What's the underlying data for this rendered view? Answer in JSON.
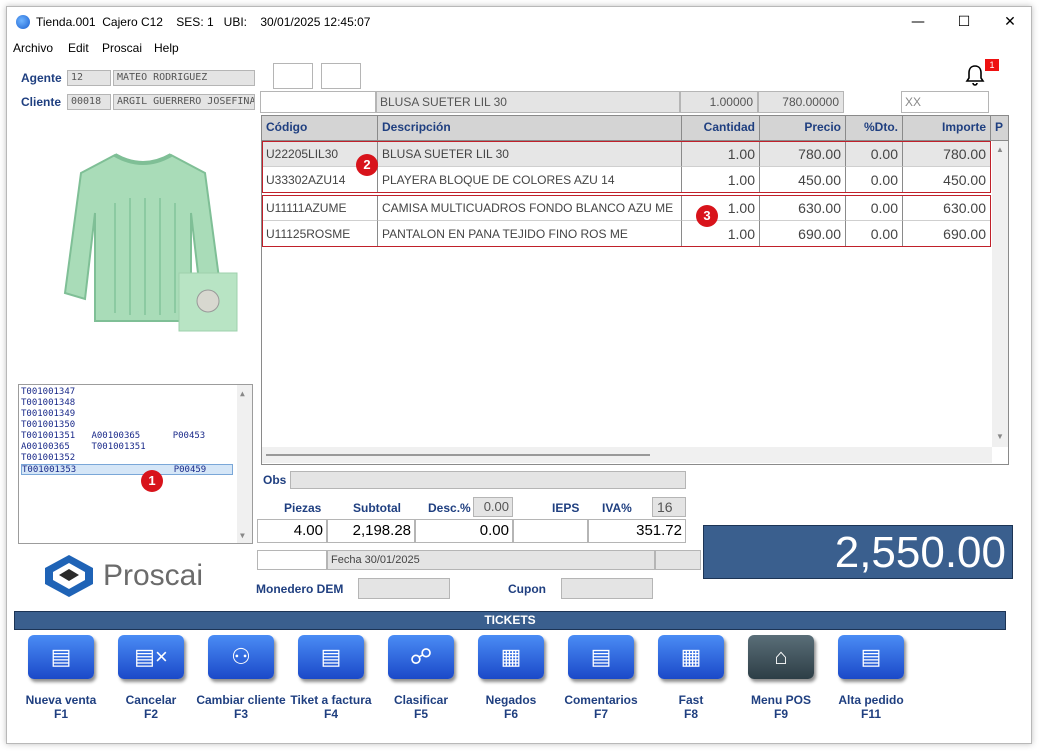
{
  "window": {
    "title": "Tienda.001  Cajero C12    SES: 1   UBI:    30/01/2025 12:45:07",
    "minimize": "—",
    "maximize": "☐",
    "close": "✕"
  },
  "menu": [
    "Archivo",
    "Edit",
    "Proscai",
    "Help"
  ],
  "notification": {
    "count": "1",
    "icon": "bell-icon"
  },
  "agente": {
    "label": "Agente",
    "code": "12",
    "name": "MATEO RODRIGUEZ"
  },
  "cliente": {
    "label": "Cliente",
    "code": "00018",
    "name": "ARGIL GUERRERO JOSEFINA"
  },
  "entry": {
    "desc": "BLUSA SUETER LIL 30",
    "qty": "1.00000",
    "price": "780.00000",
    "code": "XX"
  },
  "grid": {
    "headers": [
      "Código",
      "Descripción",
      "Cantidad",
      "Precio",
      "%Dto.",
      "Importe",
      "P"
    ],
    "rows": [
      {
        "codigo": "U22205LIL30",
        "descripcion": "BLUSA SUETER LIL 30",
        "cantidad": "1.00",
        "precio": "780.00",
        "dto": "0.00",
        "importe": "780.00"
      },
      {
        "codigo": "U33302AZU14",
        "descripcion": "PLAYERA BLOQUE DE COLORES AZU 14",
        "cantidad": "1.00",
        "precio": "450.00",
        "dto": "0.00",
        "importe": "450.00"
      },
      {
        "codigo": "U11111AZUME",
        "descripcion": "CAMISA MULTICUADROS FONDO BLANCO AZU ME",
        "cantidad": "1.00",
        "precio": "630.00",
        "dto": "0.00",
        "importe": "630.00"
      },
      {
        "codigo": "U11125ROSME",
        "descripcion": "PANTALON EN PANA  TEJIDO FINO ROS ME",
        "cantidad": "1.00",
        "precio": "690.00",
        "dto": "0.00",
        "importe": "690.00"
      }
    ]
  },
  "tickets_list": [
    "T001001347",
    "T001001348",
    "T001001349",
    "T001001350",
    "T001001351   A00100365      P00453",
    "A00100365    T001001351",
    "T001001352",
    "T001001353                  P00459"
  ],
  "annotations": [
    "1",
    "2",
    "3"
  ],
  "obs": {
    "label": "Obs",
    "value": ""
  },
  "totals": {
    "piezas_label": "Piezas",
    "piezas": "4.00",
    "subtotal_label": "Subtotal",
    "subtotal": "2,198.28",
    "desc_label": "Desc.%",
    "desc_pct": "0.00",
    "desc": "0.00",
    "ieps_label": "IEPS",
    "ieps": "",
    "iva_label": "IVA%",
    "iva_pct": "16",
    "iva": "351.72",
    "total": "2,550.00"
  },
  "fecha": "Fecha 30/01/2025",
  "monedero": {
    "label": "Monedero DEM",
    "value": ""
  },
  "cupon": {
    "label": "Cupon",
    "value": ""
  },
  "logo": "Proscai",
  "tickets_bar": "TICKETS",
  "fkeys": [
    {
      "label": "Nueva venta",
      "key": "F1",
      "icon": "new-sale-icon"
    },
    {
      "label": "Cancelar",
      "key": "F2",
      "icon": "cancel-icon"
    },
    {
      "label": "Cambiar cliente",
      "key": "F3",
      "icon": "users-icon"
    },
    {
      "label": "Tiket a factura",
      "key": "F4",
      "icon": "invoice-icon"
    },
    {
      "label": "Clasificar",
      "key": "F5",
      "icon": "classify-icon"
    },
    {
      "label": "Negados",
      "key": "F6",
      "icon": "grid-icon"
    },
    {
      "label": "Comentarios",
      "key": "F7",
      "icon": "comments-icon"
    },
    {
      "label": "Fast",
      "key": "F8",
      "icon": "fast-icon"
    },
    {
      "label": "Menu POS",
      "key": "F9",
      "icon": "home-icon"
    },
    {
      "label": "Alta pedido",
      "key": "F11",
      "icon": "new-order-icon"
    }
  ]
}
